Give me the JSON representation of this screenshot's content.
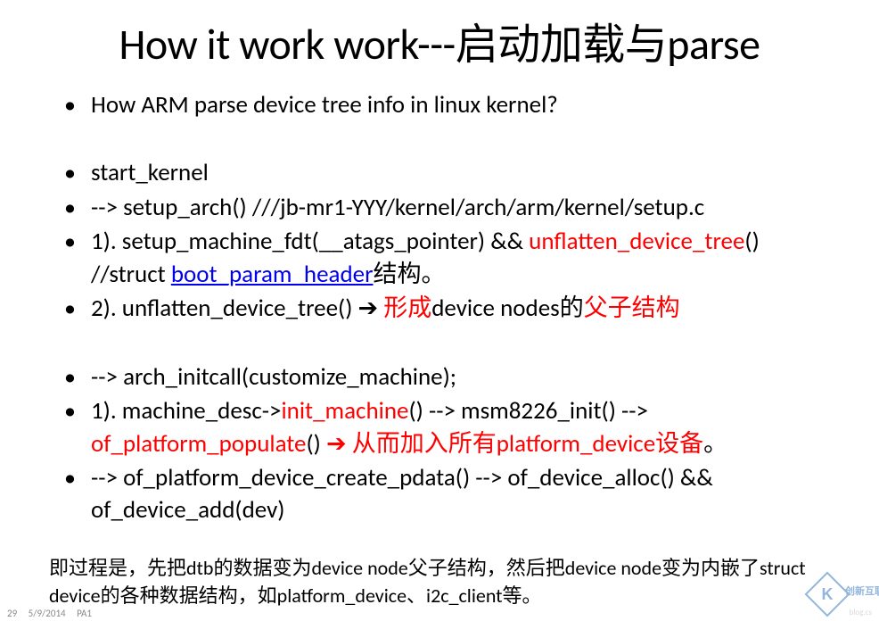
{
  "title": "How it work work---启动加载与parse",
  "bullets": {
    "b1": "How ARM parse device tree info in linux kernel?",
    "b2": "start_kernel",
    "b3": "--> setup_arch() ///jb-mr1-YYY/kernel/arch/arm/kernel/setup.c",
    "b4a": "1). setup_machine_fdt(__atags_pointer) && ",
    "b4b": "unflatten_device_tree",
    "b4c": "()     //struct ",
    "b4d": "boot_param_header",
    "b4e": "结构。",
    "b5a": "2). unflatten_device_tree()  ",
    "b5arrow": "➔",
    "b5b": " 形成",
    "b5c": "device nodes的",
    "b5d": "父子结构",
    "b6": "--> arch_initcall(customize_machine);",
    "b7a": "1). machine_desc->",
    "b7b": "init_machine",
    "b7c": "()  --> msm8226_init() --> ",
    "b7d": "of_platform_populate",
    "b7e": "()       ",
    "b7arrow": "➔",
    "b7f": " 从而加入所有platform_device设备",
    "b7g": "。",
    "b8": "   --> of_platform_device_create_pdata()  --> of_device_alloc()  && of_device_add(dev)"
  },
  "footer": "即过程是，先把dtb的数据变为device node父子结构，然后把device node变为内嵌了struct device的各种数据结构，如platform_device、i2c_client等。",
  "meta": {
    "page": "29",
    "date": "5/9/2014",
    "tag": "PA1"
  },
  "watermark": {
    "text": "创新互联",
    "tiny": "blog.cs"
  }
}
